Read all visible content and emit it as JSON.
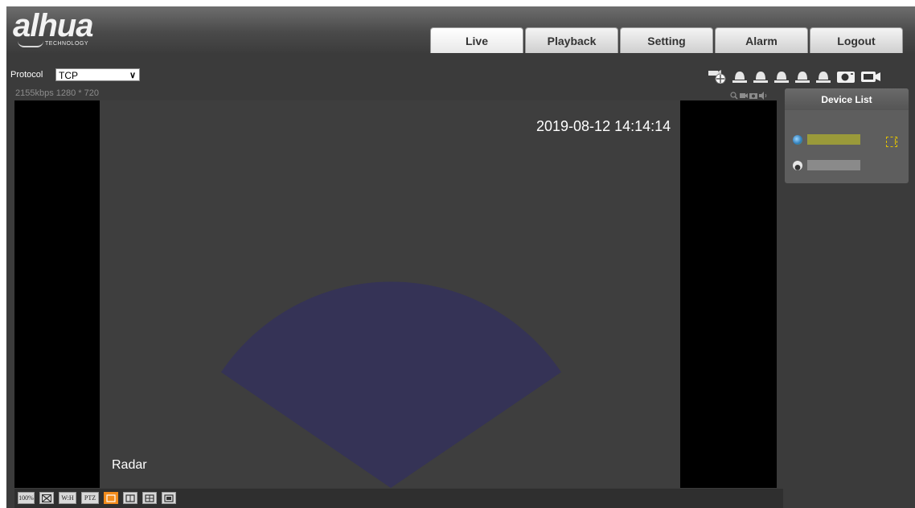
{
  "brand": {
    "logo_text": "alhua",
    "logo_sub": "TECHNOLOGY"
  },
  "nav": {
    "tabs": [
      {
        "label": "Live",
        "active": true
      },
      {
        "label": "Playback",
        "active": false
      },
      {
        "label": "Setting",
        "active": false
      },
      {
        "label": "Alarm",
        "active": false
      },
      {
        "label": "Logout",
        "active": false
      }
    ]
  },
  "toolbar": {
    "protocol_label": "Protocol",
    "protocol_value": "TCP",
    "icons": [
      "ptz-camera-icon",
      "alarm-bell-icon",
      "alarm-bell-icon",
      "alarm-bell-icon",
      "alarm-bell-icon",
      "alarm-bell-icon",
      "snapshot-icon",
      "record-icon"
    ]
  },
  "status": {
    "text": "2155kbps  1280 * 720",
    "icons": [
      "digital-zoom-icon",
      "local-record-icon",
      "snapshot-icon",
      "audio-icon"
    ]
  },
  "video": {
    "osd_time": "2019-08-12 14:14:14",
    "osd_name": "Radar",
    "radar_color": "#353356"
  },
  "bottom_bar": {
    "buttons": [
      {
        "name": "original-size-button",
        "label": "100%"
      },
      {
        "name": "fullscreen-button",
        "label": "⛶"
      },
      {
        "name": "aspect-ratio-button",
        "label": "W:H"
      },
      {
        "name": "ptz-button",
        "label": "PTZ"
      },
      {
        "name": "layout-1-button",
        "label": "",
        "active": true
      },
      {
        "name": "layout-2-button",
        "label": ""
      },
      {
        "name": "layout-4-button",
        "label": ""
      },
      {
        "name": "layout-pip-button",
        "label": ""
      }
    ]
  },
  "device_list": {
    "title": "Device List",
    "devices": [
      {
        "icon": "globe-icon"
      },
      {
        "icon": "dome-camera-icon"
      }
    ]
  },
  "colors": {
    "accent": "#f28c1c",
    "background": "#3b3b3b",
    "panel": "#5e5e5e"
  }
}
